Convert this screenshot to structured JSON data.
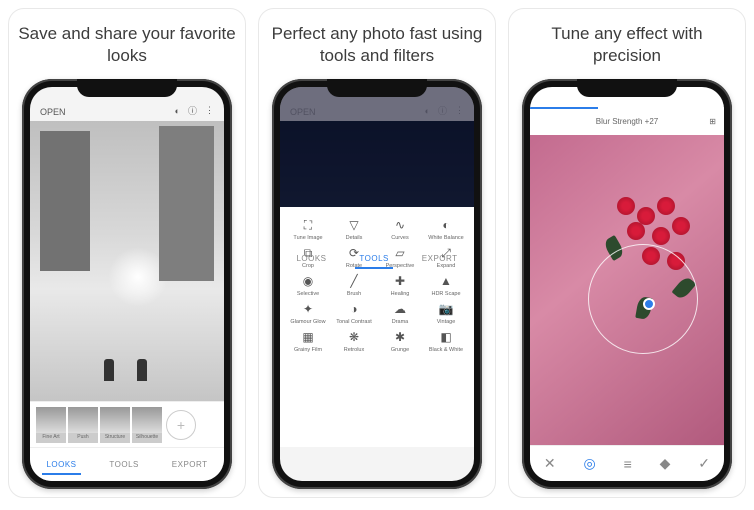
{
  "panels": [
    {
      "caption": "Save and share your favorite looks"
    },
    {
      "caption": "Perfect any photo fast using tools and filters"
    },
    {
      "caption": "Tune any effect with precision"
    }
  ],
  "p1": {
    "open": "OPEN",
    "looks": [
      "Fine Art",
      "Push",
      "Structure",
      "Silhouette"
    ],
    "nav": {
      "looks": "LOOKS",
      "tools": "TOOLS",
      "export": "EXPORT"
    }
  },
  "p2": {
    "open": "OPEN",
    "tools": [
      "Tune Image",
      "Details",
      "Curves",
      "White Balance",
      "Crop",
      "Rotate",
      "Perspective",
      "Expand",
      "Selective",
      "Brush",
      "Healing",
      "HDR Scape",
      "Glamour Glow",
      "Tonal Contrast",
      "Drama",
      "Vintage",
      "Grainy Film",
      "Retrolux",
      "Grunge",
      "Black & White"
    ],
    "nav": {
      "looks": "LOOKS",
      "tools": "TOOLS",
      "export": "EXPORT"
    }
  },
  "p3": {
    "slider_label": "Blur Strength +27",
    "actions": {
      "close": "✕",
      "target": "◎",
      "sliders": "≡",
      "styles": "◆",
      "confirm": "✓"
    }
  }
}
